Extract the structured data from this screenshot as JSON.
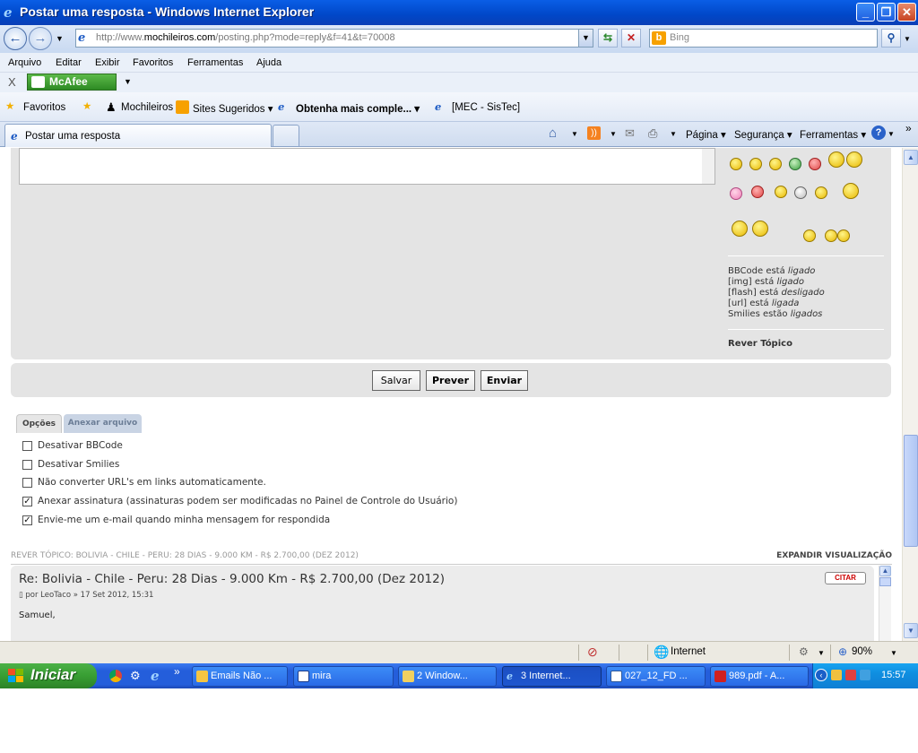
{
  "window": {
    "title": "Postar uma resposta - Windows Internet Explorer",
    "minimize": "_",
    "maximize": "❐",
    "close": "✕"
  },
  "address": {
    "url_prefix": "http://www.",
    "url_domain": "mochileiros.com",
    "url_path": "/posting.php?mode=reply&f=41&t=70008",
    "search_placeholder": "Bing"
  },
  "menu": [
    "Arquivo",
    "Editar",
    "Exibir",
    "Favoritos",
    "Ferramentas",
    "Ajuda"
  ],
  "mcafee": {
    "close": "X",
    "label": "McAfee"
  },
  "favorites": {
    "favoritos": "Favoritos",
    "items": [
      "Mochileiros",
      "Sites Sugeridos ▾",
      "Obtenha mais comple... ▾",
      "[MEC - SisTec]"
    ]
  },
  "tabs": {
    "active": "Postar uma resposta",
    "commands": [
      "Página ▾",
      "Segurança ▾",
      "Ferramentas ▾"
    ]
  },
  "page": {
    "bbcode": {
      "line1_pre": "BBCode está ",
      "line1_val": "ligado",
      "line2_pre": "[img] está ",
      "line2_val": "ligado",
      "line3_pre": "[flash] está ",
      "line3_val": "desligado",
      "line4_pre": "[url] está ",
      "line4_val": "ligada",
      "line5_pre": "Smilies estão ",
      "line5_val": "ligados"
    },
    "rever_topico": "Rever Tópico",
    "buttons": {
      "salvar": "Salvar",
      "prever": "Prever",
      "enviar": "Enviar"
    },
    "option_tabs": {
      "opcoes": "Opções",
      "anexar": "Anexar arquivo"
    },
    "options": [
      {
        "label": "Desativar BBCode",
        "checked": false
      },
      {
        "label": "Desativar Smilies",
        "checked": false
      },
      {
        "label": "Não converter URL's em links automaticamente.",
        "checked": false
      },
      {
        "label": "Anexar assinatura (assinaturas podem ser modificadas no Painel de Controle do Usuário)",
        "checked": true
      },
      {
        "label": "Envie-me um e-mail quando minha mensagem for respondida",
        "checked": true
      }
    ],
    "topic_review_label": "REVER TÓPICO: BOLIVIA - CHILE - PERU: 28 DIAS - 9.000 KM - R$ 2.700,00 (DEZ 2012)",
    "expand": "EXPANDIR VISUALIZAÇÃO",
    "post": {
      "title": "Re: Bolivia - Chile - Peru: 28 Dias - 9.000 Km - R$ 2.700,00 (Dez 2012)",
      "meta": "por LeoTaco » 17 Set 2012, 15:31",
      "body": "Samuel,",
      "quote": "CITAR"
    }
  },
  "status": {
    "zone": "Internet",
    "zoom": "90%"
  },
  "taskbar": {
    "start": "Iniciar",
    "tasks": [
      "Emails Não ...",
      "mira",
      "2 Window...",
      "3 Internet...",
      "027_12_FD ...",
      "989.pdf - A..."
    ],
    "clock": "15:57"
  }
}
